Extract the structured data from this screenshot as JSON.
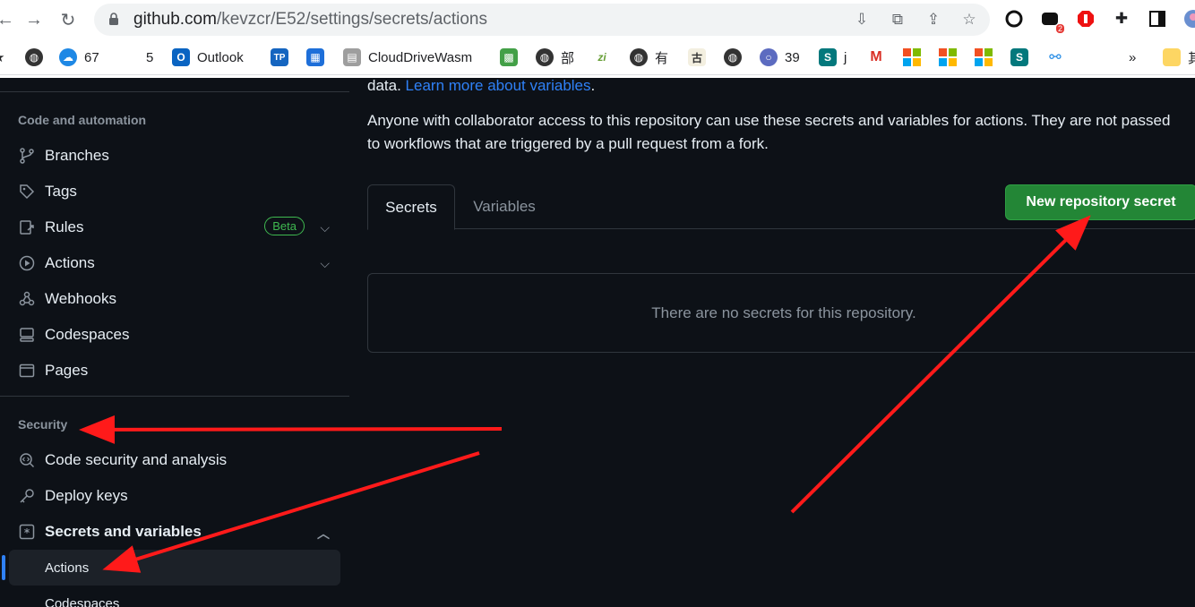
{
  "browser": {
    "url_host": "github.com",
    "url_path": "/kevzcr/E52/settings/secrets/actions",
    "ext_badge": "2",
    "bookmarks": [
      {
        "label": "67"
      },
      {
        "label": "5"
      },
      {
        "label": "Outlook"
      },
      {
        "label": "TP"
      },
      {
        "label": "CloudDriveWasm"
      },
      {
        "label": "部"
      },
      {
        "label": "zi"
      },
      {
        "label": "有"
      },
      {
        "label": "古"
      },
      {
        "label": "39"
      },
      {
        "label": "j"
      },
      {
        "label": "»"
      },
      {
        "label": "其"
      }
    ]
  },
  "sidebar": {
    "code_section_title": "Code and automation",
    "items": [
      {
        "label": "Branches"
      },
      {
        "label": "Tags"
      },
      {
        "label": "Rules",
        "badge": "Beta"
      },
      {
        "label": "Actions"
      },
      {
        "label": "Webhooks"
      },
      {
        "label": "Codespaces"
      },
      {
        "label": "Pages"
      }
    ],
    "security_section_title": "Security",
    "security_items": [
      {
        "label": "Code security and analysis"
      },
      {
        "label": "Deploy keys"
      },
      {
        "label": "Secrets and variables"
      }
    ],
    "sub_items": [
      {
        "label": "Actions"
      },
      {
        "label": "Codespaces"
      }
    ]
  },
  "main": {
    "intro_prefix": "data.",
    "intro_link": "Learn more about variables",
    "intro_suffix": ".",
    "paragraph": "Anyone with collaborator access to this repository can use these secrets and variables for actions. They are not passed to workflows that are triggered by a pull request from a fork.",
    "tabs": [
      {
        "label": "Secrets"
      },
      {
        "label": "Variables"
      }
    ],
    "new_button": "New repository secret",
    "empty_message": "There are no secrets for this repository."
  },
  "colors": {
    "background": "#0d1117",
    "accent_green": "#238636",
    "link_blue": "#2f81f7",
    "annotation_red": "#ff1a1a"
  }
}
